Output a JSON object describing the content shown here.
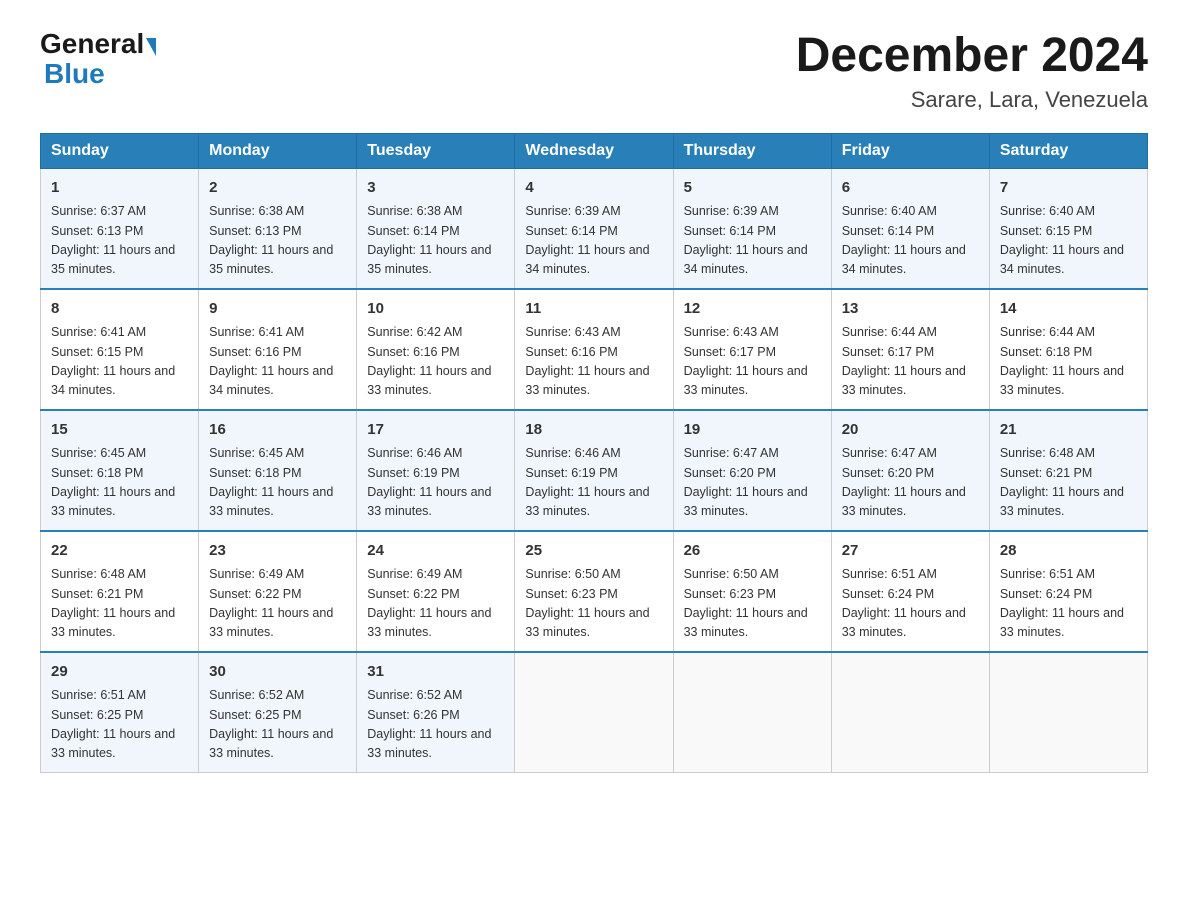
{
  "header": {
    "title": "December 2024",
    "subtitle": "Sarare, Lara, Venezuela",
    "logo_general": "General",
    "logo_blue": "Blue"
  },
  "days_of_week": [
    "Sunday",
    "Monday",
    "Tuesday",
    "Wednesday",
    "Thursday",
    "Friday",
    "Saturday"
  ],
  "weeks": [
    [
      {
        "day": "1",
        "sunrise": "6:37 AM",
        "sunset": "6:13 PM",
        "daylight": "11 hours and 35 minutes."
      },
      {
        "day": "2",
        "sunrise": "6:38 AM",
        "sunset": "6:13 PM",
        "daylight": "11 hours and 35 minutes."
      },
      {
        "day": "3",
        "sunrise": "6:38 AM",
        "sunset": "6:14 PM",
        "daylight": "11 hours and 35 minutes."
      },
      {
        "day": "4",
        "sunrise": "6:39 AM",
        "sunset": "6:14 PM",
        "daylight": "11 hours and 34 minutes."
      },
      {
        "day": "5",
        "sunrise": "6:39 AM",
        "sunset": "6:14 PM",
        "daylight": "11 hours and 34 minutes."
      },
      {
        "day": "6",
        "sunrise": "6:40 AM",
        "sunset": "6:14 PM",
        "daylight": "11 hours and 34 minutes."
      },
      {
        "day": "7",
        "sunrise": "6:40 AM",
        "sunset": "6:15 PM",
        "daylight": "11 hours and 34 minutes."
      }
    ],
    [
      {
        "day": "8",
        "sunrise": "6:41 AM",
        "sunset": "6:15 PM",
        "daylight": "11 hours and 34 minutes."
      },
      {
        "day": "9",
        "sunrise": "6:41 AM",
        "sunset": "6:16 PM",
        "daylight": "11 hours and 34 minutes."
      },
      {
        "day": "10",
        "sunrise": "6:42 AM",
        "sunset": "6:16 PM",
        "daylight": "11 hours and 33 minutes."
      },
      {
        "day": "11",
        "sunrise": "6:43 AM",
        "sunset": "6:16 PM",
        "daylight": "11 hours and 33 minutes."
      },
      {
        "day": "12",
        "sunrise": "6:43 AM",
        "sunset": "6:17 PM",
        "daylight": "11 hours and 33 minutes."
      },
      {
        "day": "13",
        "sunrise": "6:44 AM",
        "sunset": "6:17 PM",
        "daylight": "11 hours and 33 minutes."
      },
      {
        "day": "14",
        "sunrise": "6:44 AM",
        "sunset": "6:18 PM",
        "daylight": "11 hours and 33 minutes."
      }
    ],
    [
      {
        "day": "15",
        "sunrise": "6:45 AM",
        "sunset": "6:18 PM",
        "daylight": "11 hours and 33 minutes."
      },
      {
        "day": "16",
        "sunrise": "6:45 AM",
        "sunset": "6:18 PM",
        "daylight": "11 hours and 33 minutes."
      },
      {
        "day": "17",
        "sunrise": "6:46 AM",
        "sunset": "6:19 PM",
        "daylight": "11 hours and 33 minutes."
      },
      {
        "day": "18",
        "sunrise": "6:46 AM",
        "sunset": "6:19 PM",
        "daylight": "11 hours and 33 minutes."
      },
      {
        "day": "19",
        "sunrise": "6:47 AM",
        "sunset": "6:20 PM",
        "daylight": "11 hours and 33 minutes."
      },
      {
        "day": "20",
        "sunrise": "6:47 AM",
        "sunset": "6:20 PM",
        "daylight": "11 hours and 33 minutes."
      },
      {
        "day": "21",
        "sunrise": "6:48 AM",
        "sunset": "6:21 PM",
        "daylight": "11 hours and 33 minutes."
      }
    ],
    [
      {
        "day": "22",
        "sunrise": "6:48 AM",
        "sunset": "6:21 PM",
        "daylight": "11 hours and 33 minutes."
      },
      {
        "day": "23",
        "sunrise": "6:49 AM",
        "sunset": "6:22 PM",
        "daylight": "11 hours and 33 minutes."
      },
      {
        "day": "24",
        "sunrise": "6:49 AM",
        "sunset": "6:22 PM",
        "daylight": "11 hours and 33 minutes."
      },
      {
        "day": "25",
        "sunrise": "6:50 AM",
        "sunset": "6:23 PM",
        "daylight": "11 hours and 33 minutes."
      },
      {
        "day": "26",
        "sunrise": "6:50 AM",
        "sunset": "6:23 PM",
        "daylight": "11 hours and 33 minutes."
      },
      {
        "day": "27",
        "sunrise": "6:51 AM",
        "sunset": "6:24 PM",
        "daylight": "11 hours and 33 minutes."
      },
      {
        "day": "28",
        "sunrise": "6:51 AM",
        "sunset": "6:24 PM",
        "daylight": "11 hours and 33 minutes."
      }
    ],
    [
      {
        "day": "29",
        "sunrise": "6:51 AM",
        "sunset": "6:25 PM",
        "daylight": "11 hours and 33 minutes."
      },
      {
        "day": "30",
        "sunrise": "6:52 AM",
        "sunset": "6:25 PM",
        "daylight": "11 hours and 33 minutes."
      },
      {
        "day": "31",
        "sunrise": "6:52 AM",
        "sunset": "6:26 PM",
        "daylight": "11 hours and 33 minutes."
      },
      null,
      null,
      null,
      null
    ]
  ]
}
